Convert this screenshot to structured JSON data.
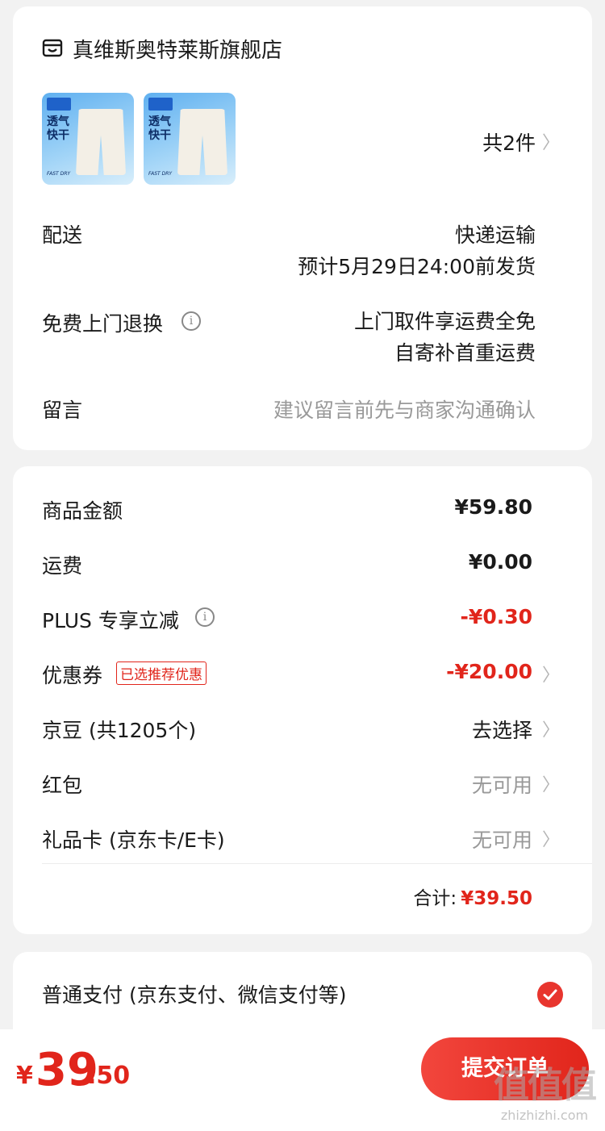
{
  "shop": {
    "name": "真维斯奥特莱斯旗舰店",
    "thumb_text_top": "透气",
    "thumb_text_bottom": "快干",
    "thumb_small": "FAST DRY",
    "item_count": "共2件",
    "delivery_label": "配送",
    "delivery_method": "快递运输",
    "delivery_time": "预计5月29日24:00前发货",
    "return_label": "免费上门退换",
    "return_line1": "上门取件享运费全免",
    "return_line2": "自寄补首重运费",
    "message_label": "留言",
    "message_placeholder": "建议留言前先与商家沟通确认"
  },
  "summary": {
    "goods_label": "商品金额",
    "goods_value": "¥59.80",
    "shipping_label": "运费",
    "shipping_value": "¥0.00",
    "plus_label": "PLUS 专享立减",
    "plus_value": "-¥0.30",
    "coupon_label": "优惠券",
    "coupon_tag": "已选推荐优惠",
    "coupon_value": "-¥20.00",
    "jingdou_label": "京豆 (共1205个)",
    "jingdou_value": "去选择",
    "redpacket_label": "红包",
    "redpacket_value": "无可用",
    "giftcard_label": "礼品卡 (京东卡/E卡)",
    "giftcard_value": "无可用",
    "total_label": "合计:",
    "total_value": "¥39.50"
  },
  "payment": {
    "method_label": "普通支付 (京东支付、微信支付等)",
    "selected": true
  },
  "bottom": {
    "yen": "¥",
    "price_int": "39",
    "price_dec": ".50",
    "submit_label": "提交订单",
    "watermark_big": "值值值",
    "watermark_small": "zhizhizhi.com"
  },
  "icons": {
    "shop": "shop-icon",
    "chevron": "chevron-right-icon",
    "info": "info-icon",
    "check": "check-circle-icon"
  },
  "colors": {
    "accent": "#e1251b",
    "background": "#f2f2f2"
  }
}
